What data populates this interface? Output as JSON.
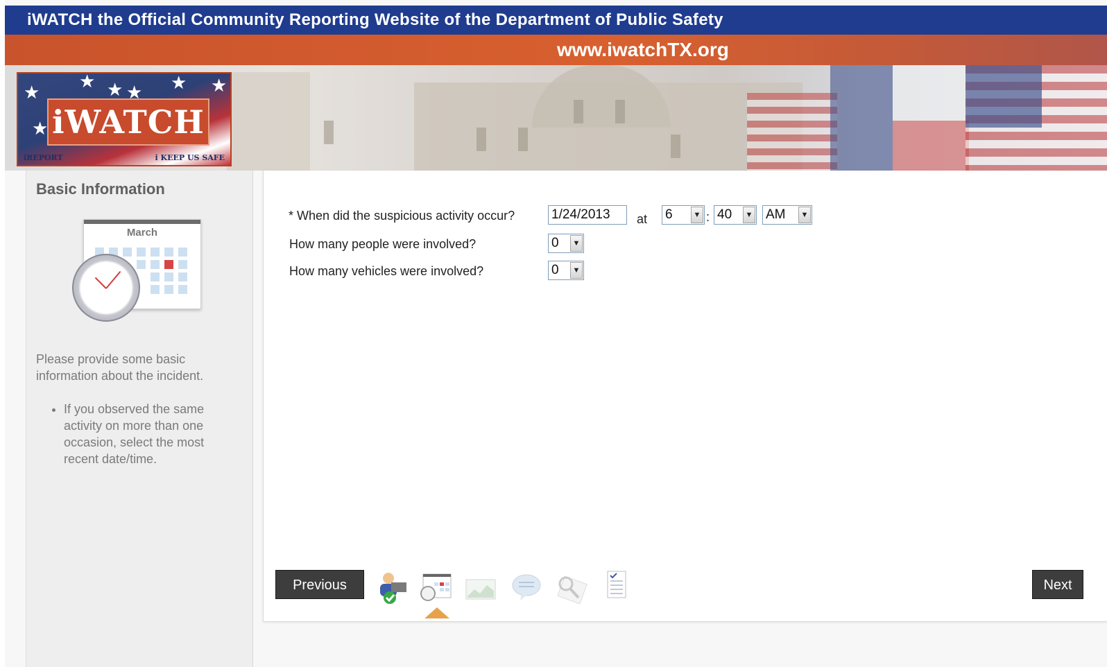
{
  "header": {
    "brand": "iWATCH",
    "tagline": "the Official Community Reporting Website of the Department of Public Safety",
    "url": "www.iwatchTX.org"
  },
  "logo": {
    "word": "iWATCH",
    "left_tag": "iREPORT",
    "right_tag": "i KEEP US SAFE"
  },
  "sidebar": {
    "title": "Basic Information",
    "calendar_month": "March",
    "description": "Please provide some basic information about the incident.",
    "tips": [
      "If you observed the same activity on more than one occasion, select the most recent date/time."
    ]
  },
  "form": {
    "when_label": "* When did the suspicious activity occur?",
    "date_value": "1/24/2013",
    "at_label": "at",
    "hour_value": "6",
    "minute_value": "40",
    "ampm_value": "AM",
    "people_label": "How many people were involved?",
    "people_value": "0",
    "vehicles_label": "How many vehicles were involved?",
    "vehicles_value": "0"
  },
  "nav": {
    "previous_label": "Previous",
    "next_label": "Next",
    "steps": [
      "person-check-icon",
      "calendar-clock-icon",
      "chart-icon",
      "speech-bubble-icon",
      "magnifier-icon",
      "checklist-icon"
    ],
    "current_step_index": 1
  },
  "colors": {
    "topbar": "#1f3c8f",
    "orangebar": "#d8602f",
    "button": "#3d3d3d"
  }
}
